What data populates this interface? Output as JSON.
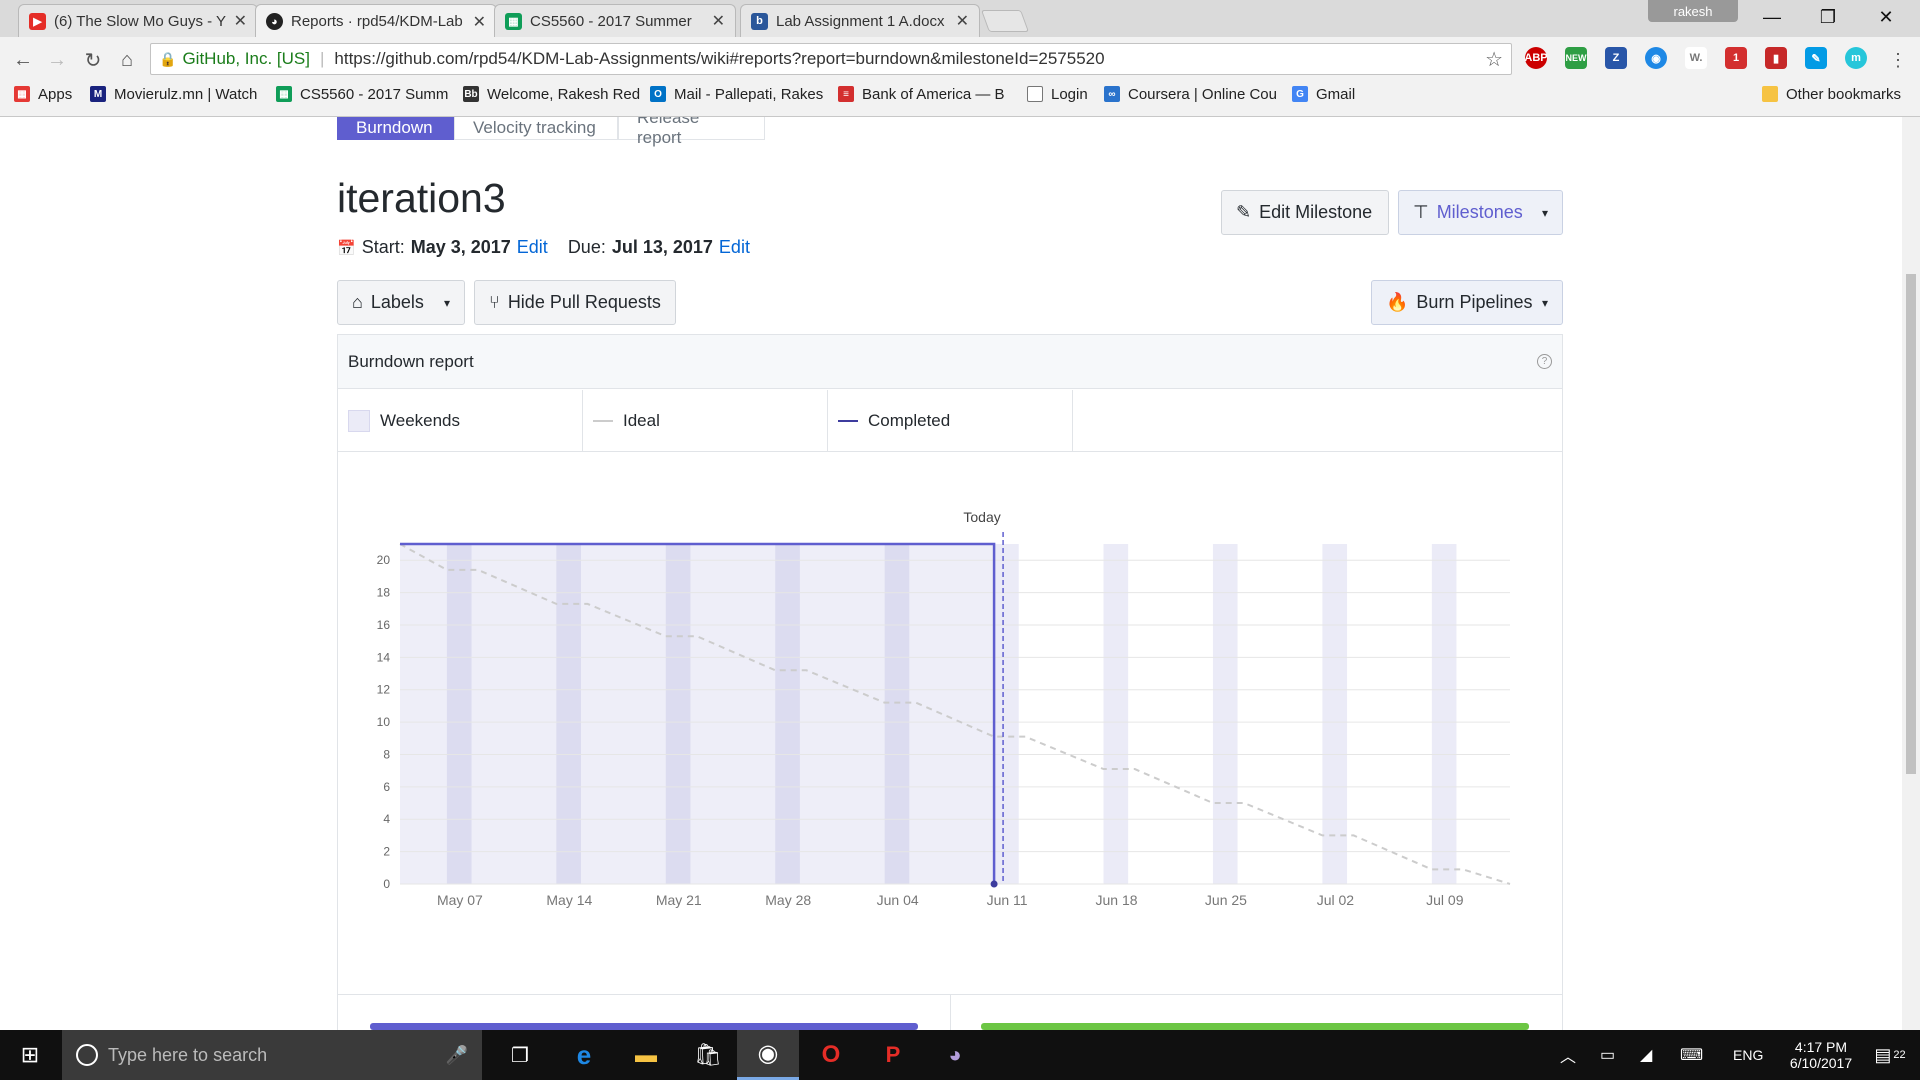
{
  "browser": {
    "tabs": [
      {
        "title": "(6) The Slow Mo Guys - Y",
        "icon": "youtube-icon",
        "color": "#e52d27",
        "active": false
      },
      {
        "title": "Reports · rpd54/KDM-Lab",
        "icon": "github-icon",
        "color": "#222222",
        "active": true
      },
      {
        "title": "CS5560 - 2017 Summer",
        "icon": "sheets-icon",
        "color": "#0f9d58",
        "active": false
      },
      {
        "title": "Lab Assignment 1 A.docx",
        "icon": "doc-icon",
        "color": "#2b579a",
        "active": false
      }
    ],
    "profile": "rakesh",
    "omnibox": {
      "org": "GitHub, Inc. [US]",
      "url": "https://github.com/rpd54/KDM-Lab-Assignments/wiki#reports?report=burndown&milestoneId=2575520"
    },
    "extensions": [
      {
        "label": "ABP",
        "color": "#c00"
      },
      {
        "label": "NEW",
        "color": "#2e9e44"
      },
      {
        "label": "Z",
        "color": "#2956a8"
      },
      {
        "label": "◉",
        "color": "#1e88e5"
      },
      {
        "label": "W.",
        "color": "#777777"
      },
      {
        "label": "1",
        "color": "#d32f2f"
      },
      {
        "label": "▮",
        "color": "#c62828"
      },
      {
        "label": "✎",
        "color": "#039be5"
      },
      {
        "label": "m",
        "color": "#26c6da"
      }
    ],
    "bookmarks": [
      {
        "label": "Apps",
        "color": "#e53935"
      },
      {
        "label": "Movierulz.mn | Watch",
        "color": "#1a237e"
      },
      {
        "label": "CS5560 - 2017 Summ",
        "color": "#0f9d58"
      },
      {
        "label": "Welcome, Rakesh Red",
        "color": "#333333"
      },
      {
        "label": "Mail - Pallepati, Rakes",
        "color": "#0072c6"
      },
      {
        "label": "Bank of America — B",
        "color": "#d32f2f"
      },
      {
        "label": "Login",
        "color": "#9e9e9e"
      },
      {
        "label": "Coursera | Online Cou",
        "color": "#2a73cc"
      },
      {
        "label": "Gmail",
        "color": "#4285f4"
      }
    ],
    "other_bookmarks": "Other bookmarks"
  },
  "report": {
    "tabs": [
      "Burndown",
      "Velocity tracking",
      "Release report"
    ],
    "title": "iteration3",
    "start_label": "Start:",
    "start_date": "May 3, 2017",
    "due_label": "Due:",
    "due_date": "Jul 13, 2017",
    "edit_label": "Edit",
    "edit_milestone": "Edit Milestone",
    "milestones": "Milestones",
    "labels": "Labels",
    "hide_prs": "Hide Pull Requests",
    "burn_pipelines": "Burn Pipelines",
    "panel_title": "Burndown report",
    "legend": [
      "Weekends",
      "Ideal",
      "Completed"
    ],
    "accent": "#5f5ecf"
  },
  "chart_data": {
    "type": "line",
    "today_label": "Today",
    "x_tick_labels": [
      "May 07",
      "May 14",
      "May 21",
      "May 28",
      "Jun 04",
      "Jun 11",
      "Jun 18",
      "Jun 25",
      "Jul 02",
      "Jul 09"
    ],
    "y_ticks": [
      0,
      2,
      4,
      6,
      8,
      10,
      12,
      14,
      16,
      18,
      20
    ],
    "ylim": [
      0,
      21
    ],
    "start_date": "2017-05-03",
    "end_date": "2017-07-13",
    "today": "2017-06-10",
    "weekend_starts": [
      "2017-05-06",
      "2017-05-13",
      "2017-05-20",
      "2017-05-27",
      "2017-06-03",
      "2017-06-10",
      "2017-06-17",
      "2017-06-24",
      "2017-07-01",
      "2017-07-08"
    ],
    "series": [
      {
        "name": "Ideal",
        "style": "dashed",
        "color": "#cccccc",
        "x": [
          "2017-05-03",
          "2017-05-06",
          "2017-05-08",
          "2017-05-13",
          "2017-05-15",
          "2017-05-20",
          "2017-05-22",
          "2017-05-27",
          "2017-05-29",
          "2017-06-03",
          "2017-06-05",
          "2017-06-10",
          "2017-06-12",
          "2017-06-17",
          "2017-06-19",
          "2017-06-24",
          "2017-06-26",
          "2017-07-01",
          "2017-07-03",
          "2017-07-08",
          "2017-07-10",
          "2017-07-13"
        ],
        "y": [
          21,
          19.4,
          19.4,
          17.3,
          17.3,
          15.3,
          15.3,
          13.2,
          13.2,
          11.2,
          11.2,
          9.1,
          9.1,
          7.1,
          7.1,
          5.0,
          5.0,
          3.0,
          3.0,
          0.9,
          0.9,
          0
        ]
      },
      {
        "name": "Completed",
        "style": "solid",
        "color": "#5f5ecf",
        "x": [
          "2017-05-03",
          "2017-06-10",
          "2017-06-10"
        ],
        "y": [
          21,
          21,
          0
        ]
      }
    ]
  },
  "taskbar": {
    "search_placeholder": "Type here to search",
    "lang": "ENG",
    "time": "4:17 PM",
    "date": "6/10/2017",
    "notifications": "22"
  }
}
